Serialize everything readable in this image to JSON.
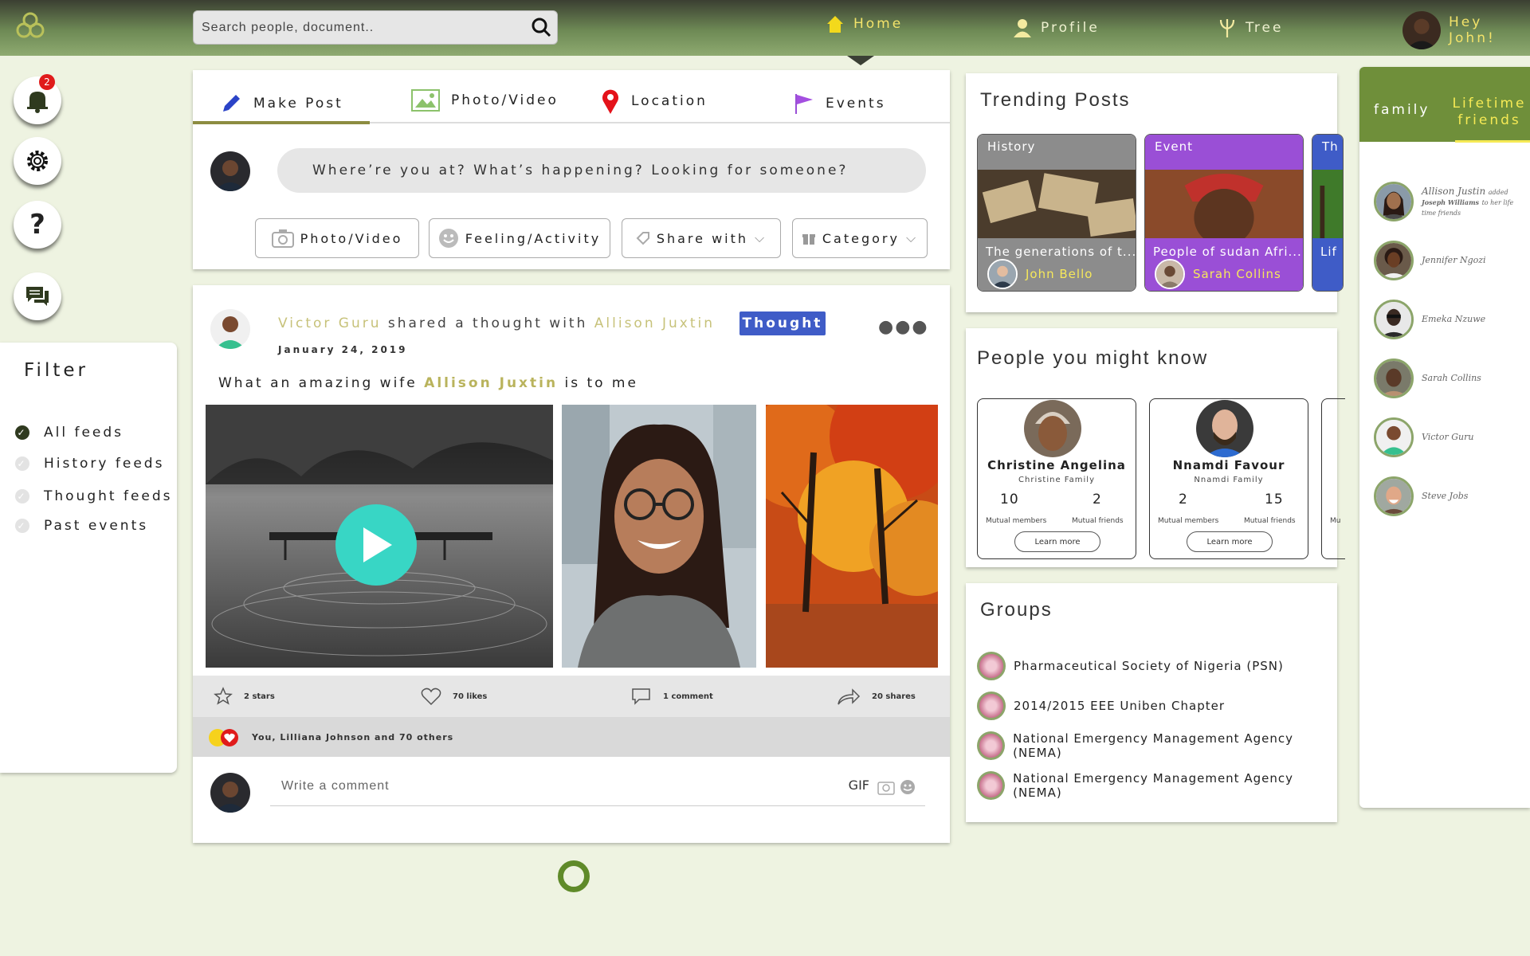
{
  "header": {
    "search_placeholder": "Search people, document..",
    "nav": {
      "home": "Home",
      "profile": "Profile",
      "tree": "Tree",
      "greeting": "Hey John!"
    }
  },
  "left_buttons": {
    "notification_count": "2"
  },
  "filter": {
    "title": "Filter",
    "items": [
      {
        "label": "All feeds",
        "checked": true
      },
      {
        "label": "History feeds",
        "checked": false
      },
      {
        "label": "Thought feeds",
        "checked": false
      },
      {
        "label": "Past events",
        "checked": false
      }
    ]
  },
  "composer": {
    "tabs": [
      "Make Post",
      "Photo/Video",
      "Location",
      "Events"
    ],
    "prompt": "Where’re you at? What’s happening? Looking for someone?",
    "buttons": [
      "Photo/Video",
      "Feeling/Activity",
      "Share with",
      "Category"
    ]
  },
  "post": {
    "author": "Victor Guru",
    "action": "shared a thought with",
    "target": "Allison Juxtin",
    "tag": "Thought",
    "date": "January 24, 2019",
    "text_before": "What an amazing wife",
    "text_name": "Allison Juxtin",
    "text_after": "is to me",
    "stats": {
      "stars": "2 stars",
      "likes": "70 likes",
      "comments": "1 comment",
      "shares": "20 shares"
    },
    "reactions": "You, Lilliana Johnson and 70 others",
    "comment_placeholder": "Write a comment",
    "gif": "GIF"
  },
  "trending": {
    "title": "Trending Posts",
    "cards": [
      {
        "category": "History",
        "caption": "The generations of t...",
        "author": "John Bello",
        "color": "#8c8c8c"
      },
      {
        "category": "Event",
        "caption": "People of sudan Afri...",
        "author": "Sarah Collins",
        "color": "#9a4fd6"
      },
      {
        "category": "Th",
        "caption": "Lif",
        "author": "",
        "color": "#3f5cc7"
      }
    ]
  },
  "people": {
    "title": "People you might know",
    "cards": [
      {
        "name": "Christine Angelina",
        "family": "Christine Family",
        "members": "10",
        "friends": "2",
        "members_label": "Mutual members",
        "friends_label": "Mutual friends",
        "cta": "Learn more"
      },
      {
        "name": "Nnamdi Favour",
        "family": "Nnamdi Family",
        "members": "2",
        "friends": "15",
        "members_label": "Mutual members",
        "friends_label": "Mutual friends",
        "cta": "Learn more"
      },
      {
        "name": "",
        "family": "",
        "members": "",
        "friends": "",
        "members_label": "Mu",
        "friends_label": "",
        "cta": ""
      }
    ]
  },
  "groups": {
    "title": "Groups",
    "items": [
      "Pharmaceutical Society of Nigeria (PSN)",
      "2014/2015 EEE Uniben Chapter",
      "National Emergency Management Agency (NEMA)",
      "National Emergency Management Agency (NEMA)"
    ]
  },
  "friends_panel": {
    "tabs": [
      "family",
      "Lifetime friends"
    ],
    "activity": {
      "name": "Allison Justin",
      "verb": "added",
      "who": "Joseph Williams",
      "rest": "to her life time friends"
    },
    "list": [
      "Jennifer Ngozi",
      "Emeka Nzuwe",
      "Sarah Collins",
      "Victor Guru",
      "Steve Jobs"
    ]
  },
  "colors": {
    "accent": "#6f8f3a",
    "gold": "#c7c27a",
    "thought": "#3f5cc7",
    "event": "#9a4fd6"
  }
}
